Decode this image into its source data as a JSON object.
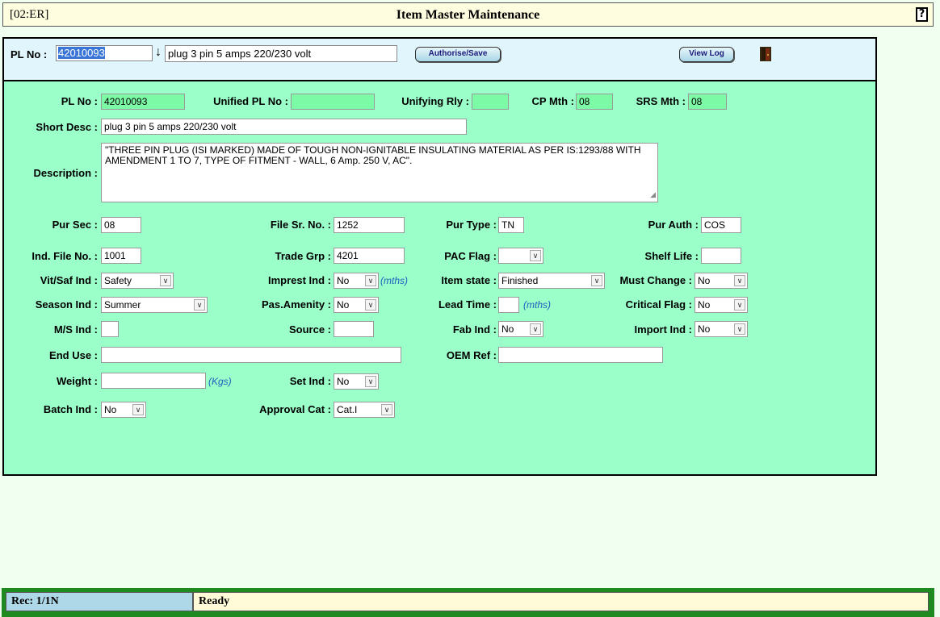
{
  "header": {
    "code": "[02:ER]",
    "title": "Item Master Maintenance",
    "help_icon": "?"
  },
  "toolbar": {
    "pl_label": "PL No :",
    "pl_value": "42010093",
    "pl_lookup_icon": "down-arrow",
    "short_desc_value": "plug 3 pin 5 amps 220/230 volt",
    "authorise_label": "Authorise/Save",
    "viewlog_label": "View Log",
    "exit_icon": "door-exit"
  },
  "form": {
    "pl_no": {
      "label": "PL No :",
      "value": "42010093"
    },
    "unified_pl_no": {
      "label": "Unified PL No :",
      "value": ""
    },
    "unifying_rly": {
      "label": "Unifying Rly :",
      "value": ""
    },
    "cp_mth": {
      "label": "CP Mth :",
      "value": "08"
    },
    "srs_mth": {
      "label": "SRS Mth :",
      "value": "08"
    },
    "short_desc": {
      "label": "Short Desc :",
      "value": "plug 3 pin 5 amps 220/230 volt"
    },
    "description": {
      "label": "Description :",
      "value": "\"THREE PIN PLUG (ISI MARKED) MADE OF TOUGH NON-IGNITABLE INSULATING MATERIAL AS PER IS:1293/88 WITH AMENDMENT 1 TO 7, TYPE OF FITMENT - WALL, 6 Amp. 250 V, AC\"."
    },
    "pur_sec": {
      "label": "Pur Sec :",
      "value": "08"
    },
    "file_sr_no": {
      "label": "File Sr. No. :",
      "value": "1252"
    },
    "pur_type": {
      "label": "Pur Type :",
      "value": "TN"
    },
    "pur_auth": {
      "label": "Pur Auth :",
      "value": "COS"
    },
    "ind_file_no": {
      "label": "Ind. File No. :",
      "value": "1001"
    },
    "trade_grp": {
      "label": "Trade Grp :",
      "value": "4201"
    },
    "pac_flag": {
      "label": "PAC Flag :",
      "value": ""
    },
    "shelf_life": {
      "label": "Shelf Life :",
      "value": ""
    },
    "vit_saf_ind": {
      "label": "Vit/Saf Ind :",
      "value": "Safety"
    },
    "imprest_ind": {
      "label": "Imprest Ind :",
      "value": "No",
      "unit": "(mths)"
    },
    "item_state": {
      "label": "Item state :",
      "value": "Finished"
    },
    "must_change": {
      "label": "Must Change :",
      "value": "No"
    },
    "season_ind": {
      "label": "Season Ind :",
      "value": "Summer"
    },
    "pas_amenity": {
      "label": "Pas.Amenity :",
      "value": "No"
    },
    "lead_time": {
      "label": "Lead Time :",
      "value": "",
      "unit": "(mths)"
    },
    "critical_flag": {
      "label": "Critical Flag :",
      "value": "No"
    },
    "ms_ind": {
      "label": "M/S Ind :",
      "value": ""
    },
    "source": {
      "label": "Source :",
      "value": ""
    },
    "fab_ind": {
      "label": "Fab Ind :",
      "value": "No"
    },
    "import_ind": {
      "label": "Import Ind :",
      "value": "No"
    },
    "end_use": {
      "label": "End Use :",
      "value": ""
    },
    "oem_ref": {
      "label": "OEM Ref :",
      "value": ""
    },
    "weight": {
      "label": "Weight :",
      "value": "",
      "unit": "(Kgs)"
    },
    "set_ind": {
      "label": "Set Ind :",
      "value": "No"
    },
    "batch_ind": {
      "label": "Batch Ind :",
      "value": "No"
    },
    "approval_cat": {
      "label": "Approval Cat :",
      "value": "Cat.I"
    }
  },
  "status": {
    "record": "Rec: 1/1N",
    "message": "Ready"
  },
  "colors": {
    "title_bg": "#fffde0",
    "top_panel_bg": "#e0f6fc",
    "form_bg": "#9bffc9",
    "readonly_field": "#7dfaa6",
    "status_border": "#1f8a1f"
  }
}
